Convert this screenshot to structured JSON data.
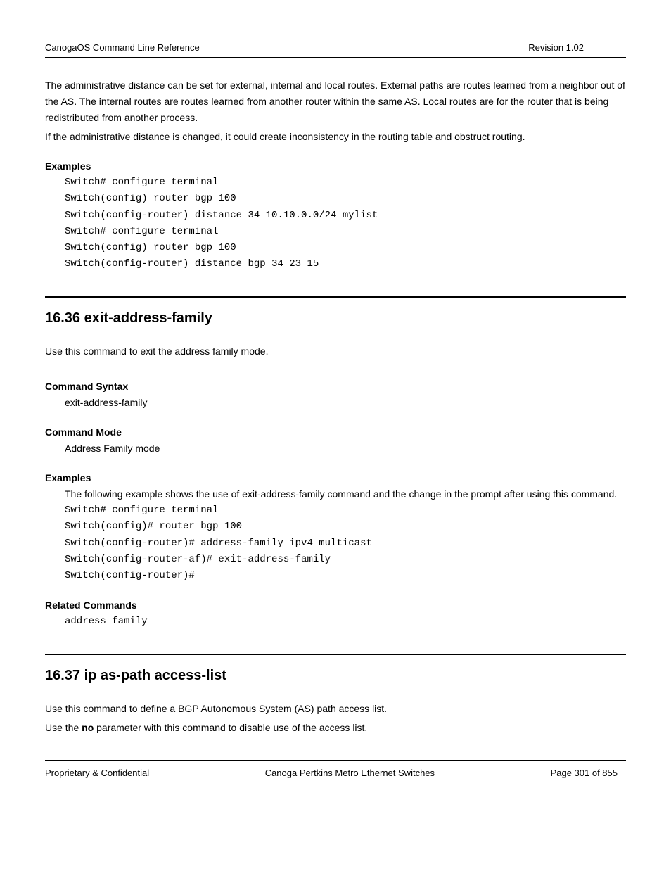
{
  "header": {
    "left": "CanogaOS Command Line Reference",
    "right": "Revision 1.02"
  },
  "intro": {
    "p1": "The administrative distance can be set for external, internal and local routes. External paths are routes learned from a neighbor out of the AS. The internal routes are routes learned from another router within the same AS. Local routes are for the router that is being redistributed from another process.",
    "p2": "If the administrative distance is changed, it could create inconsistency in the routing table and obstruct routing."
  },
  "block1": {
    "examples_label": "Examples",
    "code": "Switch# configure terminal\nSwitch(config) router bgp 100\nSwitch(config-router) distance 34 10.10.0.0/24 mylist\nSwitch# configure terminal\nSwitch(config) router bgp 100\nSwitch(config-router) distance bgp 34 23 15"
  },
  "sec36": {
    "title": "16.36  exit-address-family",
    "desc": "Use this command to exit the address family mode.",
    "syntax_label": "Command Syntax",
    "syntax_value": "exit-address-family",
    "mode_label": "Command Mode",
    "mode_value": "Address Family mode",
    "examples_label": "Examples",
    "examples_desc": "The following example shows the use of exit-address-family command and the change in the prompt after using this command.",
    "code": "Switch# configure terminal\nSwitch(config)# router bgp 100\nSwitch(config-router)# address-family ipv4 multicast\nSwitch(config-router-af)# exit-address-family\nSwitch(config-router)#",
    "related_label": "Related Commands",
    "related_value": "address family"
  },
  "sec37": {
    "title": "16.37  ip as-path access-list",
    "desc1": "Use this command to define a BGP Autonomous System (AS) path access list.",
    "desc2_pre": "Use the ",
    "desc2_bold": "no",
    "desc2_post": " parameter with this command to disable use of the access list."
  },
  "footer": {
    "left": "Proprietary & Confidential",
    "center": "Canoga Pertkins Metro Ethernet Switches",
    "right": "Page 301 of 855"
  }
}
